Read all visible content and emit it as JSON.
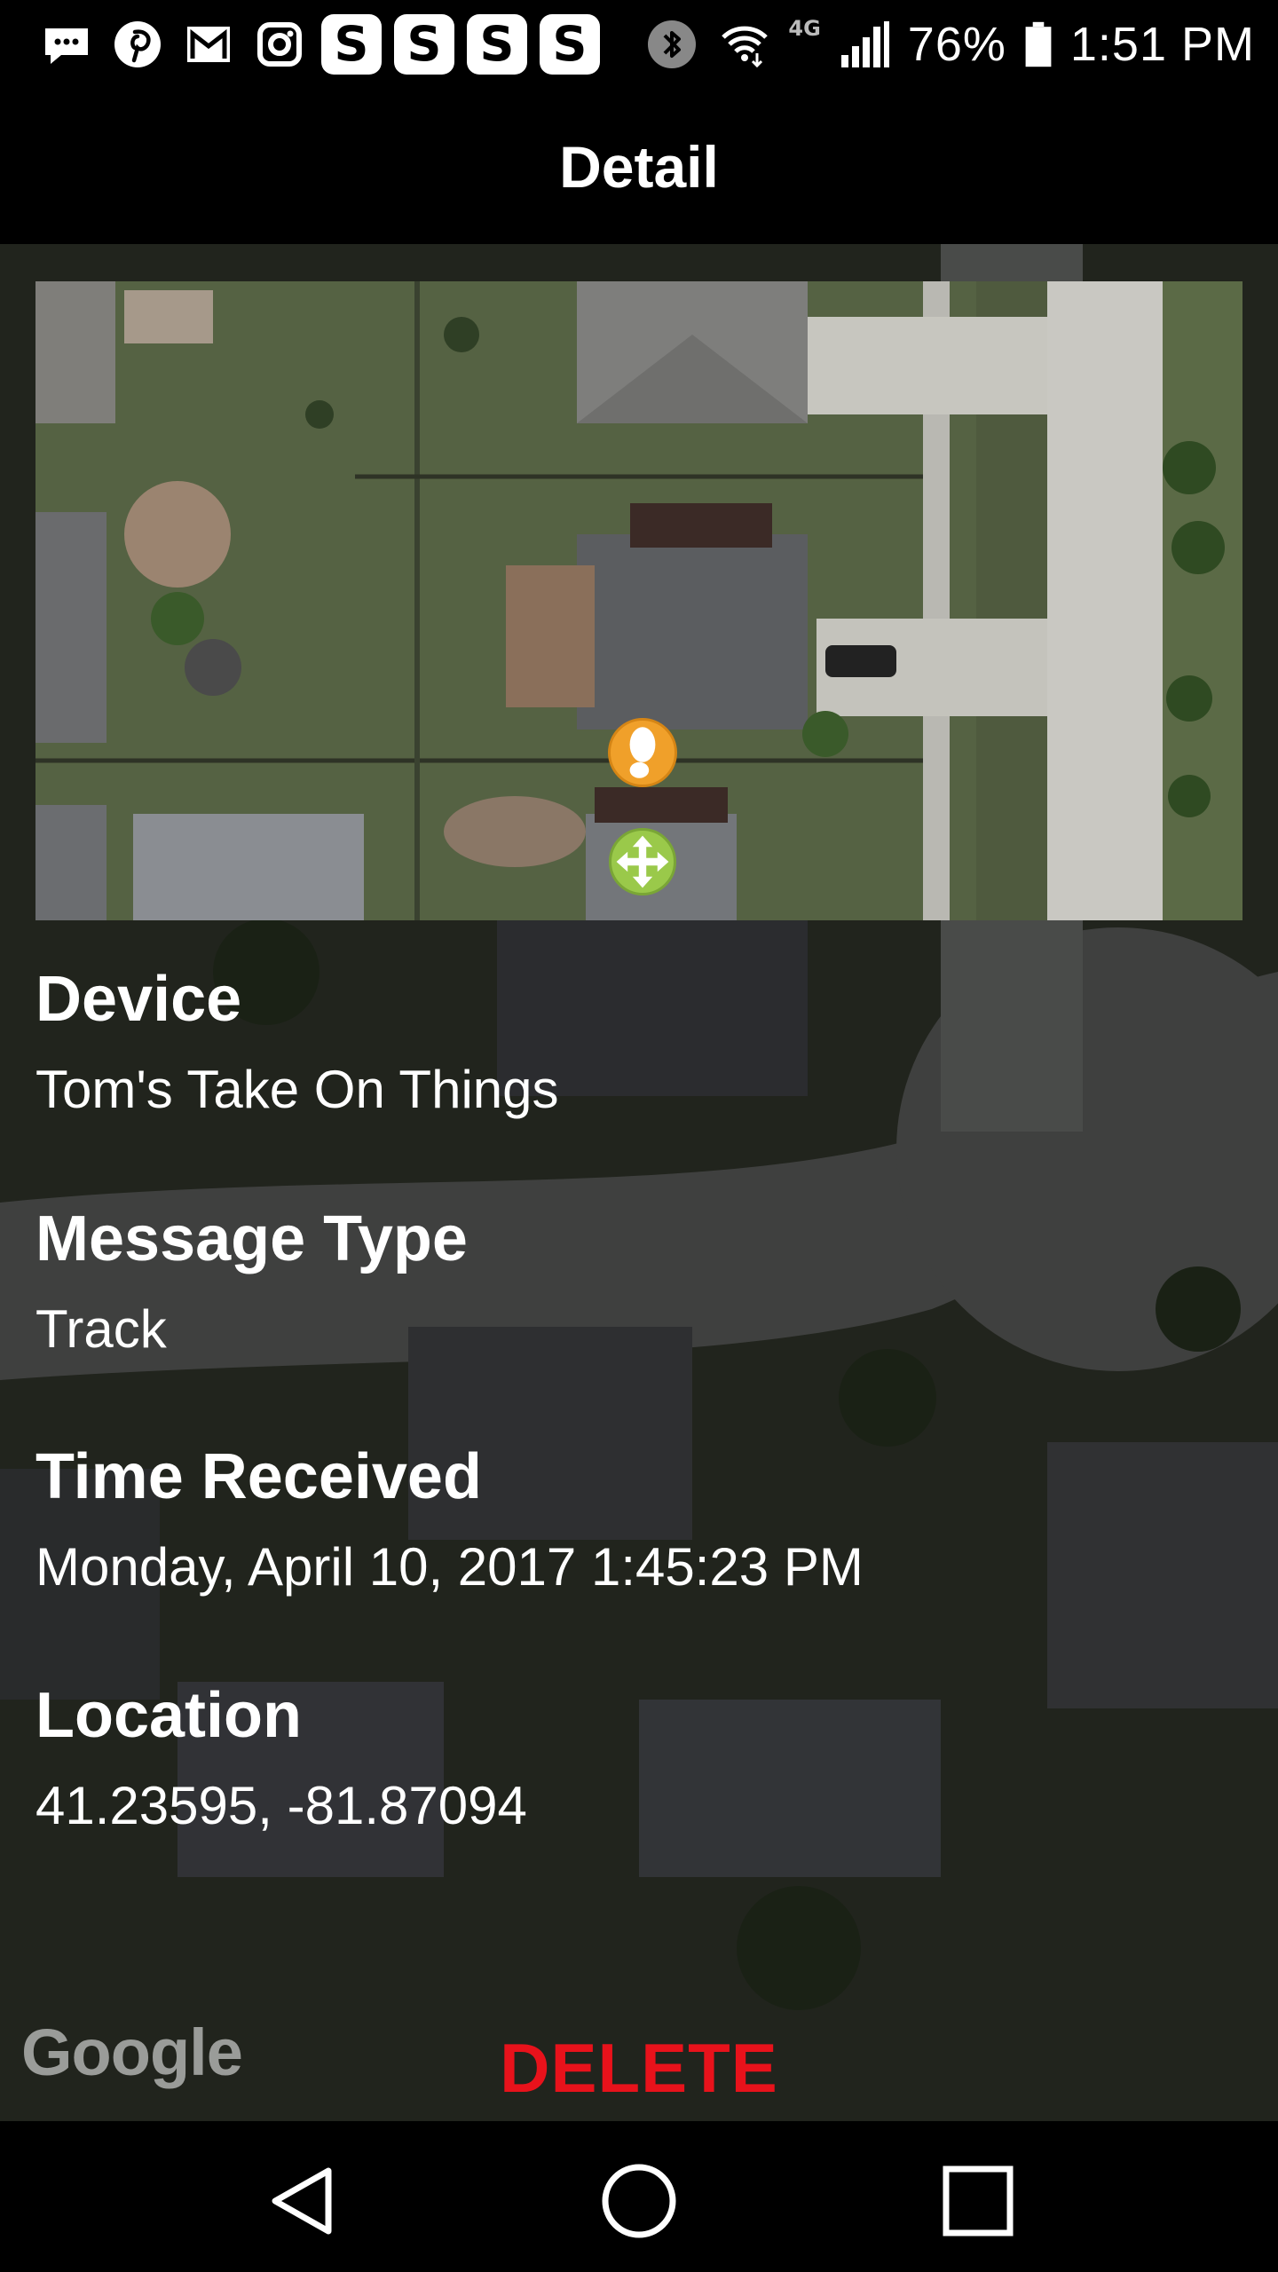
{
  "status_bar": {
    "left_icons": [
      "message-icon",
      "pinterest-icon",
      "gmail-icon",
      "instagram-icon",
      "s-app-icon",
      "s-app-icon",
      "s-app-icon",
      "s-app-icon"
    ],
    "s_app_glyph": "S",
    "right_icons": [
      "bluetooth-icon",
      "wifi-icon",
      "signal-icon",
      "battery-icon"
    ],
    "network": "4G",
    "battery": "76%",
    "time": "1:51 PM"
  },
  "header": {
    "title": "Detail"
  },
  "detail": {
    "fields": [
      {
        "label": "Device",
        "value": "Tom's Take On Things"
      },
      {
        "label": "Message Type",
        "value": "Track"
      },
      {
        "label": "Time Received",
        "value": "Monday, April 10, 2017 1:45:23 PM"
      },
      {
        "label": "Location",
        "value": "41.23595, -81.87094"
      }
    ]
  },
  "actions": {
    "delete_label": "DELETE"
  },
  "map": {
    "attribution": "Google"
  },
  "colors": {
    "delete": "#e8121b",
    "marker_track": "#f0a02a",
    "marker_move": "#9ac94a"
  },
  "nav_bar": {
    "icons": [
      "back-icon",
      "home-icon",
      "recents-icon"
    ]
  }
}
